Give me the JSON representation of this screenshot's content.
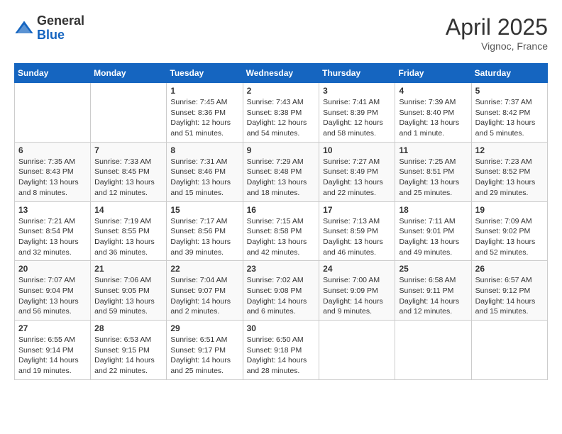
{
  "logo": {
    "general": "General",
    "blue": "Blue"
  },
  "title": {
    "month_year": "April 2025",
    "location": "Vignoc, France"
  },
  "days_of_week": [
    "Sunday",
    "Monday",
    "Tuesday",
    "Wednesday",
    "Thursday",
    "Friday",
    "Saturday"
  ],
  "weeks": [
    [
      {
        "day": "",
        "info": ""
      },
      {
        "day": "",
        "info": ""
      },
      {
        "day": "1",
        "info": "Sunrise: 7:45 AM\nSunset: 8:36 PM\nDaylight: 12 hours and 51 minutes."
      },
      {
        "day": "2",
        "info": "Sunrise: 7:43 AM\nSunset: 8:38 PM\nDaylight: 12 hours and 54 minutes."
      },
      {
        "day": "3",
        "info": "Sunrise: 7:41 AM\nSunset: 8:39 PM\nDaylight: 12 hours and 58 minutes."
      },
      {
        "day": "4",
        "info": "Sunrise: 7:39 AM\nSunset: 8:40 PM\nDaylight: 13 hours and 1 minute."
      },
      {
        "day": "5",
        "info": "Sunrise: 7:37 AM\nSunset: 8:42 PM\nDaylight: 13 hours and 5 minutes."
      }
    ],
    [
      {
        "day": "6",
        "info": "Sunrise: 7:35 AM\nSunset: 8:43 PM\nDaylight: 13 hours and 8 minutes."
      },
      {
        "day": "7",
        "info": "Sunrise: 7:33 AM\nSunset: 8:45 PM\nDaylight: 13 hours and 12 minutes."
      },
      {
        "day": "8",
        "info": "Sunrise: 7:31 AM\nSunset: 8:46 PM\nDaylight: 13 hours and 15 minutes."
      },
      {
        "day": "9",
        "info": "Sunrise: 7:29 AM\nSunset: 8:48 PM\nDaylight: 13 hours and 18 minutes."
      },
      {
        "day": "10",
        "info": "Sunrise: 7:27 AM\nSunset: 8:49 PM\nDaylight: 13 hours and 22 minutes."
      },
      {
        "day": "11",
        "info": "Sunrise: 7:25 AM\nSunset: 8:51 PM\nDaylight: 13 hours and 25 minutes."
      },
      {
        "day": "12",
        "info": "Sunrise: 7:23 AM\nSunset: 8:52 PM\nDaylight: 13 hours and 29 minutes."
      }
    ],
    [
      {
        "day": "13",
        "info": "Sunrise: 7:21 AM\nSunset: 8:54 PM\nDaylight: 13 hours and 32 minutes."
      },
      {
        "day": "14",
        "info": "Sunrise: 7:19 AM\nSunset: 8:55 PM\nDaylight: 13 hours and 36 minutes."
      },
      {
        "day": "15",
        "info": "Sunrise: 7:17 AM\nSunset: 8:56 PM\nDaylight: 13 hours and 39 minutes."
      },
      {
        "day": "16",
        "info": "Sunrise: 7:15 AM\nSunset: 8:58 PM\nDaylight: 13 hours and 42 minutes."
      },
      {
        "day": "17",
        "info": "Sunrise: 7:13 AM\nSunset: 8:59 PM\nDaylight: 13 hours and 46 minutes."
      },
      {
        "day": "18",
        "info": "Sunrise: 7:11 AM\nSunset: 9:01 PM\nDaylight: 13 hours and 49 minutes."
      },
      {
        "day": "19",
        "info": "Sunrise: 7:09 AM\nSunset: 9:02 PM\nDaylight: 13 hours and 52 minutes."
      }
    ],
    [
      {
        "day": "20",
        "info": "Sunrise: 7:07 AM\nSunset: 9:04 PM\nDaylight: 13 hours and 56 minutes."
      },
      {
        "day": "21",
        "info": "Sunrise: 7:06 AM\nSunset: 9:05 PM\nDaylight: 13 hours and 59 minutes."
      },
      {
        "day": "22",
        "info": "Sunrise: 7:04 AM\nSunset: 9:07 PM\nDaylight: 14 hours and 2 minutes."
      },
      {
        "day": "23",
        "info": "Sunrise: 7:02 AM\nSunset: 9:08 PM\nDaylight: 14 hours and 6 minutes."
      },
      {
        "day": "24",
        "info": "Sunrise: 7:00 AM\nSunset: 9:09 PM\nDaylight: 14 hours and 9 minutes."
      },
      {
        "day": "25",
        "info": "Sunrise: 6:58 AM\nSunset: 9:11 PM\nDaylight: 14 hours and 12 minutes."
      },
      {
        "day": "26",
        "info": "Sunrise: 6:57 AM\nSunset: 9:12 PM\nDaylight: 14 hours and 15 minutes."
      }
    ],
    [
      {
        "day": "27",
        "info": "Sunrise: 6:55 AM\nSunset: 9:14 PM\nDaylight: 14 hours and 19 minutes."
      },
      {
        "day": "28",
        "info": "Sunrise: 6:53 AM\nSunset: 9:15 PM\nDaylight: 14 hours and 22 minutes."
      },
      {
        "day": "29",
        "info": "Sunrise: 6:51 AM\nSunset: 9:17 PM\nDaylight: 14 hours and 25 minutes."
      },
      {
        "day": "30",
        "info": "Sunrise: 6:50 AM\nSunset: 9:18 PM\nDaylight: 14 hours and 28 minutes."
      },
      {
        "day": "",
        "info": ""
      },
      {
        "day": "",
        "info": ""
      },
      {
        "day": "",
        "info": ""
      }
    ]
  ]
}
